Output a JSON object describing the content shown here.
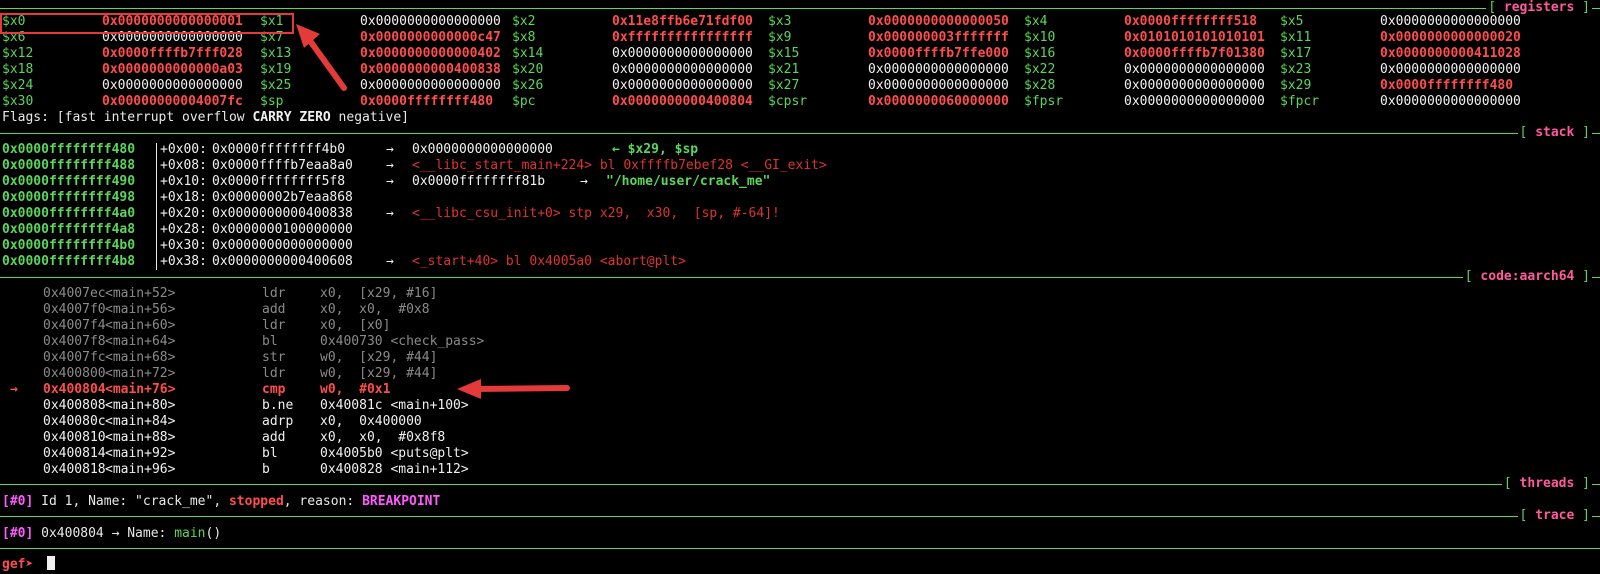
{
  "sections": {
    "registers": "registers",
    "stack": "stack",
    "code": "code:aarch64",
    "threads": "threads",
    "trace": "trace"
  },
  "registers": [
    [
      [
        "$x0",
        "0x0000000000000001",
        true
      ],
      [
        "$x1",
        "0x0000000000000000",
        false
      ],
      [
        "$x2",
        "0x11e8ffb6e71fdf00",
        true
      ],
      [
        "$x3",
        "0x0000000000000050",
        true
      ],
      [
        "$x4",
        "0x0000ffffffff518",
        true
      ],
      [
        "$x5",
        "0x0000000000000000",
        false
      ]
    ],
    [
      [
        "$x6",
        "0x0000000000000000",
        false
      ],
      [
        "$x7",
        "0x0000000000000c47",
        true
      ],
      [
        "$x8",
        "0xffffffffffffffff",
        true
      ],
      [
        "$x9",
        "0x000000003fffffff",
        true
      ],
      [
        "$x10",
        "0x0101010101010101",
        true
      ],
      [
        "$x11",
        "0x0000000000000020",
        true
      ]
    ],
    [
      [
        "$x12",
        "0x0000ffffb7fff028",
        true
      ],
      [
        "$x13",
        "0x0000000000000402",
        true
      ],
      [
        "$x14",
        "0x0000000000000000",
        false
      ],
      [
        "$x15",
        "0x0000ffffb7ffe000",
        true
      ],
      [
        "$x16",
        "0x0000ffffb7f01380",
        true
      ],
      [
        "$x17",
        "0x0000000000411028",
        true
      ]
    ],
    [
      [
        "$x18",
        "0x0000000000000a03",
        true
      ],
      [
        "$x19",
        "0x0000000000400838",
        true
      ],
      [
        "$x20",
        "0x0000000000000000",
        false
      ],
      [
        "$x21",
        "0x0000000000000000",
        false
      ],
      [
        "$x22",
        "0x0000000000000000",
        false
      ],
      [
        "$x23",
        "0x0000000000000000",
        false
      ]
    ],
    [
      [
        "$x24",
        "0x0000000000000000",
        false
      ],
      [
        "$x25",
        "0x0000000000000000",
        false
      ],
      [
        "$x26",
        "0x0000000000000000",
        false
      ],
      [
        "$x27",
        "0x0000000000000000",
        false
      ],
      [
        "$x28",
        "0x0000000000000000",
        false
      ],
      [
        "$x29",
        "0x0000ffffffff480",
        true
      ]
    ],
    [
      [
        "$x30",
        "0x00000000004007fc",
        true
      ],
      [
        "$sp",
        "0x0000ffffffff480",
        true
      ],
      [
        "$pc",
        "0x0000000000400804",
        true
      ],
      [
        "$cpsr",
        "0x0000000060000000",
        true
      ],
      [
        "$fpsr",
        "0x0000000000000000",
        false
      ],
      [
        "$fpcr",
        "0x0000000000000000",
        false
      ]
    ]
  ],
  "flags": {
    "prefix": "Flags: [fast interrupt overflow ",
    "carry": "CARRY",
    "zero": "ZERO",
    "suffix": " negative]"
  },
  "stack": [
    {
      "addr": "0x0000ffffffff480",
      "off": "+0x00:",
      "val": "0x0000ffffffff4b0",
      "arrow": "→",
      "deref": "0x0000000000000000",
      "note": "← $x29, $sp",
      "note_type": "green",
      "deref2": ""
    },
    {
      "addr": "0x0000ffffffff488",
      "off": "+0x08:",
      "val": "0x0000ffffb7eaa8a0",
      "arrow": "→",
      "deref": "",
      "note": "<__libc_start_main+224> bl 0xffffb7ebef28 <__GI_exit>",
      "note_type": "red",
      "deref2": ""
    },
    {
      "addr": "0x0000ffffffff490",
      "off": "+0x10:",
      "val": "0x0000ffffffff5f8",
      "arrow": "→",
      "deref": "0x0000ffffffff81b",
      "note": "\"/home/user/crack_me\"",
      "note_type": "green",
      "deref2": "→"
    },
    {
      "addr": "0x0000ffffffff498",
      "off": "+0x18:",
      "val": "0x00000002b7eaa868",
      "arrow": "",
      "deref": "",
      "note": "",
      "note_type": "",
      "deref2": ""
    },
    {
      "addr": "0x0000ffffffff4a0",
      "off": "+0x20:",
      "val": "0x0000000000400838",
      "arrow": "→",
      "deref": "",
      "note": "<__libc_csu_init+0> stp x29,  x30,  [sp, #-64]!",
      "note_type": "red",
      "deref2": ""
    },
    {
      "addr": "0x0000ffffffff4a8",
      "off": "+0x28:",
      "val": "0x0000000100000000",
      "arrow": "",
      "deref": "",
      "note": "",
      "note_type": "",
      "deref2": ""
    },
    {
      "addr": "0x0000ffffffff4b0",
      "off": "+0x30:",
      "val": "0x0000000000000000",
      "arrow": "",
      "deref": "",
      "note": "",
      "note_type": "",
      "deref2": ""
    },
    {
      "addr": "0x0000ffffffff4b8",
      "off": "+0x38:",
      "val": "0x0000000000400608",
      "arrow": "→",
      "deref": "",
      "note": "<_start+40> bl 0x4005a0 <abort@plt>",
      "note_type": "red",
      "deref2": ""
    }
  ],
  "code": [
    {
      "addr": "0x4007ec",
      "sym": "<main+52>",
      "op": "ldr",
      "args": "x0,  [x29, #16]",
      "state": "past"
    },
    {
      "addr": "0x4007f0",
      "sym": "<main+56>",
      "op": "add",
      "args": "x0,  x0,  #0x8",
      "state": "past"
    },
    {
      "addr": "0x4007f4",
      "sym": "<main+60>",
      "op": "ldr",
      "args": "x0,  [x0]",
      "state": "past"
    },
    {
      "addr": "0x4007f8",
      "sym": "<main+64>",
      "op": "bl",
      "args": "0x400730 <check_pass>",
      "state": "past"
    },
    {
      "addr": "0x4007fc",
      "sym": "<main+68>",
      "op": "str",
      "args": "w0,  [x29, #44]",
      "state": "past"
    },
    {
      "addr": "0x400800",
      "sym": "<main+72>",
      "op": "ldr",
      "args": "w0,  [x29, #44]",
      "state": "past"
    },
    {
      "addr": "0x400804",
      "sym": "<main+76>",
      "op": "cmp",
      "args": "w0,  #0x1",
      "state": "current"
    },
    {
      "addr": "0x400808",
      "sym": "<main+80>",
      "op": "b.ne",
      "args": "0x40081c <main+100>",
      "state": "next"
    },
    {
      "addr": "0x40080c",
      "sym": "<main+84>",
      "op": "adrp",
      "args": "x0,  0x400000",
      "state": "next"
    },
    {
      "addr": "0x400810",
      "sym": "<main+88>",
      "op": "add",
      "args": "x0,  x0,  #0x8f8",
      "state": "next"
    },
    {
      "addr": "0x400814",
      "sym": "<main+92>",
      "op": "bl",
      "args": "0x4005b0 <puts@plt>",
      "state": "next"
    },
    {
      "addr": "0x400818",
      "sym": "<main+96>",
      "op": "b",
      "args": "0x400828 <main+112>",
      "state": "next"
    }
  ],
  "code_marker": "→",
  "threads": {
    "idx": "[#0]",
    "text1": " Id 1, Name: \"crack_me\", ",
    "state": "stopped",
    "text2": ", reason: ",
    "reason": "BREAKPOINT"
  },
  "trace": {
    "idx": "[#0]",
    "text1": " 0x400804 → Name: ",
    "fn": "main",
    "text2": "()"
  },
  "prompt": "gef➤"
}
